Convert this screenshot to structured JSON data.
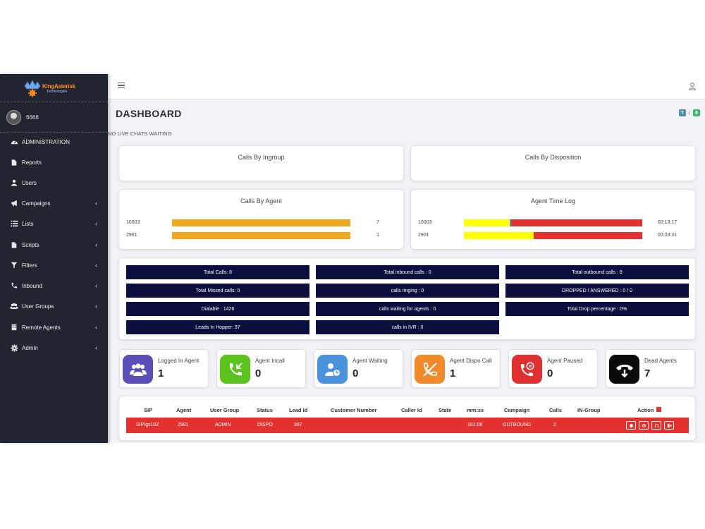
{
  "brand": {
    "name": "KingAsterisk",
    "sub": "Technologies"
  },
  "user": {
    "name": "6666"
  },
  "sidebar": {
    "items": [
      {
        "label": "ADMINISTRATION",
        "icon": "gauge-icon",
        "chevron": false
      },
      {
        "label": "Reports",
        "icon": "file-icon",
        "chevron": false
      },
      {
        "label": "Users",
        "icon": "user-icon",
        "chevron": false
      },
      {
        "label": "Campaigns",
        "icon": "megaphone-icon",
        "chevron": true
      },
      {
        "label": "Lists",
        "icon": "list-icon",
        "chevron": true
      },
      {
        "label": "Scripts",
        "icon": "file-icon",
        "chevron": true
      },
      {
        "label": "Filters",
        "icon": "filter-icon",
        "chevron": true
      },
      {
        "label": "Inbound",
        "icon": "phone-icon",
        "chevron": true
      },
      {
        "label": "User Groups",
        "icon": "users-icon",
        "chevron": true
      },
      {
        "label": "Remote Agents",
        "icon": "building-icon",
        "chevron": true
      },
      {
        "label": "Admin",
        "icon": "gear-icon",
        "chevron": true
      }
    ]
  },
  "header": {
    "title": "DASHBOARD",
    "crumb_sep": "/",
    "chat_note": "NO LIVE CHATS WAITING"
  },
  "panels": {
    "ingroup": {
      "title": "Calls By Ingroup"
    },
    "disposition": {
      "title": "Calls By Disposition"
    },
    "agent": {
      "title": "Calls By Agent",
      "rows": [
        {
          "agent": "10003",
          "value": "7",
          "fill": 1.0,
          "color": "#f0a81f"
        },
        {
          "agent": "2901",
          "value": "1",
          "fill": 1.0,
          "color": "#f0a81f"
        }
      ]
    },
    "timelog": {
      "title": "Agent Time Log",
      "rows": [
        {
          "agent": "10003",
          "time": "00:13:17",
          "segments": [
            {
              "color": "#ffff00",
              "frac": 0.255
            },
            {
              "color": "#4f8cd6",
              "frac": 0.008
            },
            {
              "color": "#e53030",
              "frac": 0.737
            }
          ]
        },
        {
          "agent": "2901",
          "time": "00:03:31",
          "segments": [
            {
              "color": "#ffff00",
              "frac": 0.39
            },
            {
              "color": "#e53030",
              "frac": 0.61
            }
          ]
        }
      ]
    }
  },
  "stats": [
    "Total Calls: 8",
    "Total inbound calls : 0",
    "Total outbound calls : 8",
    "Total Missed calls: 0",
    "calls ringing : 0",
    "DROPPED / ANSWERED : 0 / 0",
    "Dialable : 1426",
    "calls waiting for agents : 0",
    "Total Drop percentage : 0%",
    "Leads In Hopper: 97",
    "calls in IVR : 0"
  ],
  "agent_status": [
    {
      "label": "Logged In Agent",
      "value": "1",
      "color": "#5a4fb8",
      "icon": "users-icon"
    },
    {
      "label": "Agent Incall",
      "value": "0",
      "color": "#5cc31e",
      "icon": "incoming-call-icon"
    },
    {
      "label": "Agent Waiting",
      "value": "0",
      "color": "#4a92dd",
      "icon": "user-clock-icon"
    },
    {
      "label": "Agent Dispo Call",
      "value": "1",
      "color": "#f08a2a",
      "icon": "phone-slash-icon"
    },
    {
      "label": "Agent Paused",
      "value": "0",
      "color": "#e02f2f",
      "icon": "phone-pause-icon"
    },
    {
      "label": "Dead Agents",
      "value": "7",
      "color": "#0a0a0a",
      "icon": "hangup-icon"
    }
  ],
  "table": {
    "headers": [
      "SIP",
      "Agent",
      "User Group",
      "Status",
      "Lead Id",
      "Customer Number",
      "Caller Id",
      "State",
      "mm:ss",
      "Campaign",
      "Calls",
      "IN-Group",
      "Action"
    ],
    "row": {
      "sip": "SIP/gs102",
      "agent": "2901",
      "group": "ADMIN",
      "status": "DISPO",
      "lead": "367",
      "customer": "",
      "caller": "",
      "state": "",
      "time": "181:08",
      "campaign": "OUTBOUND",
      "calls": "2",
      "ingroup": ""
    },
    "row_color": "#e53030"
  }
}
